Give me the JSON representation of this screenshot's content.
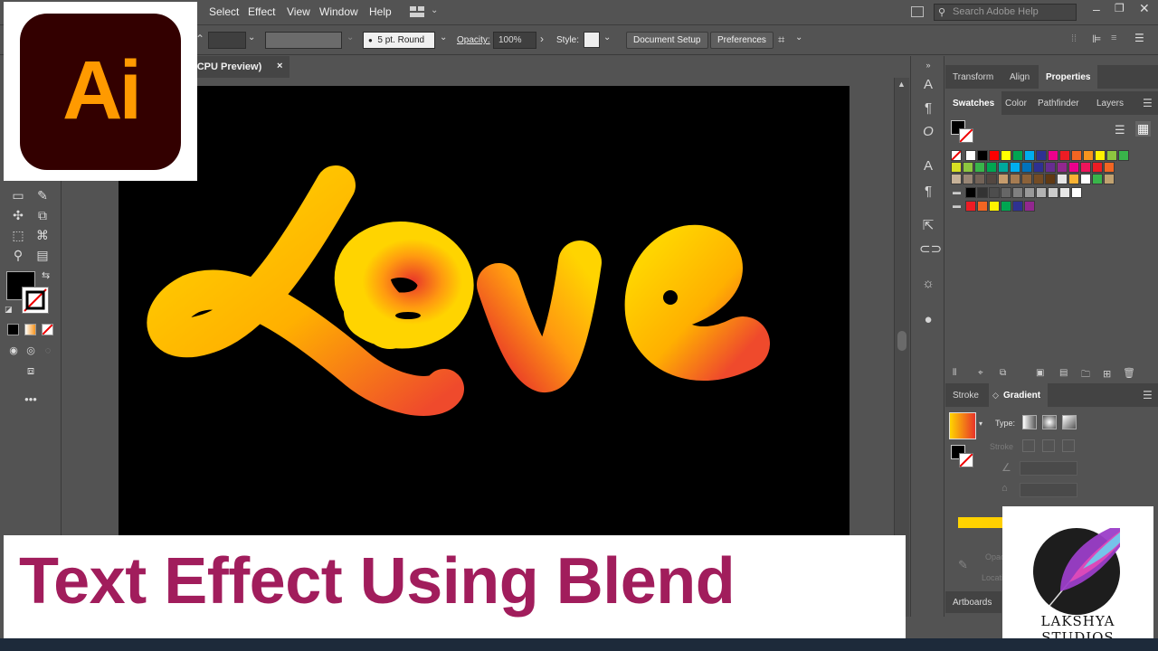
{
  "menubar": {
    "items": [
      "Select",
      "Effect",
      "View",
      "Window",
      "Help"
    ],
    "search_placeholder": "Search Adobe Help"
  },
  "controlbar": {
    "stroke_profile": "5 pt. Round",
    "opacity_label": "Opacity:",
    "opacity_value": "100%",
    "style_label": "Style:",
    "document_setup": "Document Setup",
    "preferences": "Preferences"
  },
  "document_tab": {
    "title": "(/CPU Preview)",
    "close": "×"
  },
  "artwork": {
    "text": "Love",
    "gradient_start": "#ffd400",
    "gradient_end": "#e8342a"
  },
  "panels": {
    "top_tabs": [
      "Transform",
      "Align",
      "Properties"
    ],
    "swatch_tabs": [
      "Swatches",
      "Color",
      "Pathfinder",
      "Layers"
    ],
    "gradient_tabs": [
      "Stroke",
      "Gradient"
    ],
    "gradient": {
      "type_label": "Type:",
      "stroke_label": "Stroke",
      "opacity_label": "Opac",
      "location_label": "Locati"
    },
    "artboards_label": "Artboards"
  },
  "swatch_colors": {
    "row1": [
      "#ffffff",
      "#000000",
      "#ff0000",
      "#ffff00",
      "#00a651",
      "#00aeef",
      "#2e3192",
      "#ec008c",
      "#ed1c24",
      "#f26522",
      "#f7941d",
      "#fff200",
      "#8dc63f",
      "#39b54a"
    ],
    "row2": [
      "#d7df23",
      "#8dc63f",
      "#39b54a",
      "#00a651",
      "#00a99d",
      "#00aeef",
      "#0072bc",
      "#2e3192",
      "#662d91",
      "#92278f",
      "#ec008c",
      "#ed145b",
      "#ed1c24",
      "#f26522"
    ],
    "row3": [
      "#c7b299",
      "#998675",
      "#736357",
      "#534741",
      "#c69c6d",
      "#a67c52",
      "#8c6239",
      "#754c24",
      "#603913",
      "#e6e6e6",
      "#f9b233",
      "#ffffff",
      "#39b54a",
      "#c1a270"
    ],
    "row4": [
      "#000000",
      "#333333",
      "#4d4d4d",
      "#666666",
      "#808080",
      "#999999",
      "#b3b3b3",
      "#cccccc",
      "#e6e6e6",
      "#ffffff"
    ],
    "row5": [
      "#ed1c24",
      "#f26522",
      "#fff200",
      "#00a651",
      "#2e3192",
      "#92278f"
    ]
  },
  "logo": {
    "app": "Ai",
    "app_bg": "#330000",
    "app_fg": "#ff9a00"
  },
  "banner": {
    "title": "Text Effect Using Blend",
    "color": "#a11d5c"
  },
  "studio": {
    "name": "LAKSHYA STUDIOS"
  }
}
